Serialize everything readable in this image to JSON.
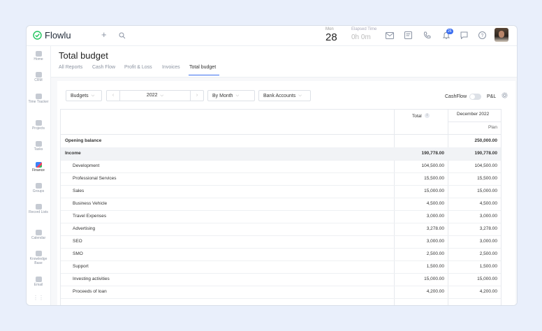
{
  "app": {
    "name": "Flowlu"
  },
  "topbar": {
    "month": "Mon",
    "day": "28",
    "elapsed_label": "Elapsed Time",
    "elapsed_value": "0h 0m",
    "notification_count": "26"
  },
  "sidebar": {
    "items": [
      {
        "label": "Home",
        "icon": "home-icon"
      },
      {
        "label": "CRM",
        "icon": "crm-icon"
      },
      {
        "label": "Time Tracker",
        "icon": "clock-icon"
      },
      {
        "label": "Projects",
        "icon": "projects-icon"
      },
      {
        "label": "Tasks",
        "icon": "tasks-icon"
      },
      {
        "label": "Finance",
        "icon": "finance-icon"
      },
      {
        "label": "Groups",
        "icon": "groups-icon"
      },
      {
        "label": "Record Lists",
        "icon": "lists-icon"
      },
      {
        "label": "Calendar",
        "icon": "calendar-icon"
      },
      {
        "label": "Knowledge Base",
        "icon": "book-icon"
      },
      {
        "label": "Email",
        "icon": "email-icon"
      }
    ]
  },
  "page": {
    "title": "Total budget"
  },
  "tabs": [
    "All Reports",
    "Cash Flow",
    "Profit & Loss",
    "Invoices",
    "Total budget"
  ],
  "filters": {
    "budgets": "Budgets",
    "year": "2022",
    "period": "By Month",
    "accounts": "Bank Accounts",
    "cashflow_label": "CashFlow",
    "pl_label": "P&L"
  },
  "table": {
    "col_total": "Total",
    "col_month": "December 2022",
    "col_plan": "Plan",
    "rows": [
      {
        "label": "Opening balance",
        "total": "",
        "plan": "250,000.00"
      },
      {
        "label": "Income",
        "total": "190,778.00",
        "plan": "190,778.00"
      },
      {
        "label": "Development",
        "total": "104,500.00",
        "plan": "104,500.00"
      },
      {
        "label": "Professional Services",
        "total": "15,500.00",
        "plan": "15,500.00"
      },
      {
        "label": "Sales",
        "total": "15,000.00",
        "plan": "15,000.00"
      },
      {
        "label": "Business Vehicle",
        "total": "4,500.00",
        "plan": "4,500.00"
      },
      {
        "label": "Travel Expenses",
        "total": "3,000.00",
        "plan": "3,000.00"
      },
      {
        "label": "Advertising",
        "total": "3,278.00",
        "plan": "3,278.00"
      },
      {
        "label": "SEO",
        "total": "3,000.00",
        "plan": "3,000.00"
      },
      {
        "label": "SMO",
        "total": "2,500.00",
        "plan": "2,500.00"
      },
      {
        "label": "Support",
        "total": "1,500.00",
        "plan": "1,500.00"
      },
      {
        "label": "Investing activities",
        "total": "15,000.00",
        "plan": "15,000.00"
      },
      {
        "label": "Proceeds of loan",
        "total": "4,200.00",
        "plan": "4,200.00"
      }
    ]
  }
}
